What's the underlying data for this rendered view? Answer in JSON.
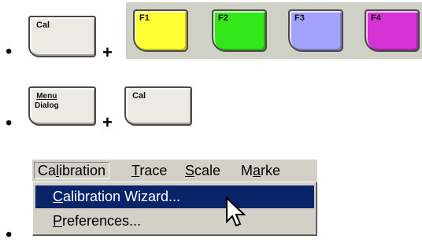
{
  "bullet": "•",
  "plus": "+",
  "row1": {
    "cal_key_label": "Cal",
    "fkeys": [
      {
        "label": "F1",
        "color": "#ffff33"
      },
      {
        "label": "F2",
        "color": "#33e619"
      },
      {
        "label": "F3",
        "color": "#a3a3ff"
      },
      {
        "label": "F4",
        "color": "#d633d6"
      }
    ]
  },
  "row2": {
    "menu_dialog_top": "Menu",
    "menu_dialog_bottom": "Dialog",
    "cal_key_label": "Cal"
  },
  "menubar": {
    "items": [
      {
        "pre": "Ca",
        "ul": "l",
        "post": "ibration"
      },
      {
        "pre": "",
        "ul": "T",
        "post": "race"
      },
      {
        "pre": "",
        "ul": "S",
        "post": "cale"
      },
      {
        "pre": "M",
        "ul": "a",
        "post": "rke"
      }
    ]
  },
  "dropdown": {
    "items": [
      {
        "pre": "",
        "ul": "C",
        "post": "alibration Wizard..."
      },
      {
        "pre": "",
        "ul": "P",
        "post": "references..."
      }
    ]
  },
  "cursor": "arrow-pointer-icon"
}
